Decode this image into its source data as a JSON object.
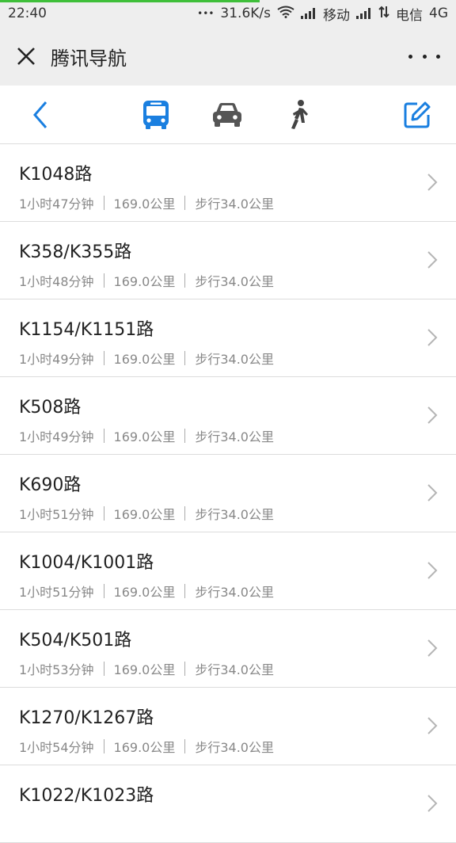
{
  "status": {
    "time": "22:40",
    "dots": "•••",
    "speed": "31.6K/s",
    "carrier1": "移动",
    "carrier2": "电信",
    "network": "4G",
    "progress_fraction": 0.57,
    "progress_color": "#3fbf3a"
  },
  "header": {
    "title": "腾讯导航"
  },
  "modes": {
    "active": "bus",
    "accent_color": "#1a7fe0",
    "icons": [
      "back-icon",
      "bus-icon",
      "car-icon",
      "walk-icon",
      "edit-icon"
    ]
  },
  "routes": [
    {
      "name": "K1048路",
      "duration": "1小时47分钟",
      "distance": "169.0公里",
      "walk": "步行34.0公里"
    },
    {
      "name": "K358/K355路",
      "duration": "1小时48分钟",
      "distance": "169.0公里",
      "walk": "步行34.0公里"
    },
    {
      "name": "K1154/K1151路",
      "duration": "1小时49分钟",
      "distance": "169.0公里",
      "walk": "步行34.0公里"
    },
    {
      "name": "K508路",
      "duration": "1小时49分钟",
      "distance": "169.0公里",
      "walk": "步行34.0公里"
    },
    {
      "name": "K690路",
      "duration": "1小时51分钟",
      "distance": "169.0公里",
      "walk": "步行34.0公里"
    },
    {
      "name": "K1004/K1001路",
      "duration": "1小时51分钟",
      "distance": "169.0公里",
      "walk": "步行34.0公里"
    },
    {
      "name": "K504/K501路",
      "duration": "1小时53分钟",
      "distance": "169.0公里",
      "walk": "步行34.0公里"
    },
    {
      "name": "K1270/K1267路",
      "duration": "1小时54分钟",
      "distance": "169.0公里",
      "walk": "步行34.0公里"
    },
    {
      "name": "K1022/K1023路",
      "duration": "",
      "distance": "",
      "walk": ""
    }
  ]
}
